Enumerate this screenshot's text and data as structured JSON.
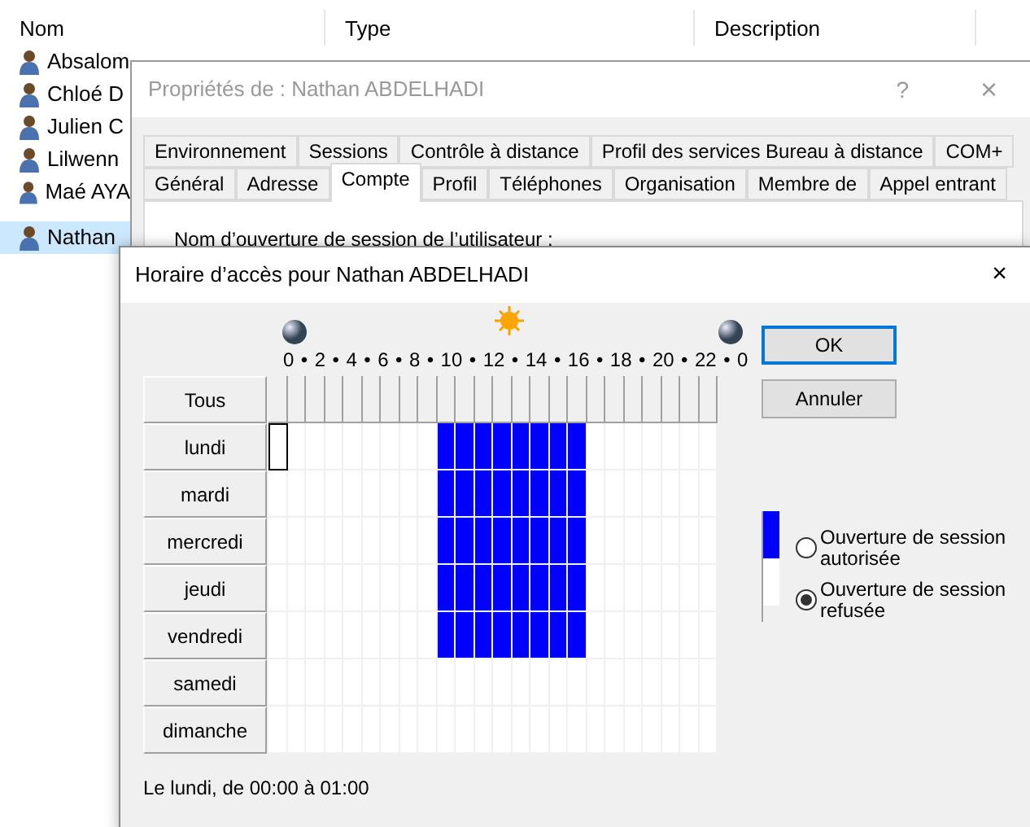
{
  "list": {
    "columns": [
      "Nom",
      "Type",
      "Description"
    ],
    "rows": [
      {
        "name": "Absalom",
        "selected": false
      },
      {
        "name": "Chloé D",
        "selected": false
      },
      {
        "name": "Julien C",
        "selected": false
      },
      {
        "name": "Lilwenn",
        "selected": false
      },
      {
        "name": "Maé AYA",
        "selected": false
      },
      {
        "name": "Nathan",
        "selected": true
      }
    ]
  },
  "properties": {
    "title": "Propriétés de : Nathan ABDELHADI",
    "help": "?",
    "close": "×",
    "tab_rows": [
      [
        {
          "label": "Environnement",
          "selected": false
        },
        {
          "label": "Sessions",
          "selected": false
        },
        {
          "label": "Contrôle à distance",
          "selected": false
        },
        {
          "label": "Profil des services Bureau à distance",
          "selected": false
        },
        {
          "label": "COM+",
          "selected": false
        }
      ],
      [
        {
          "label": "Général",
          "selected": false
        },
        {
          "label": "Adresse",
          "selected": false
        },
        {
          "label": "Compte",
          "selected": true
        },
        {
          "label": "Profil",
          "selected": false
        },
        {
          "label": "Téléphones",
          "selected": false
        },
        {
          "label": "Organisation",
          "selected": false
        },
        {
          "label": "Membre de",
          "selected": false
        },
        {
          "label": "Appel entrant",
          "selected": false
        }
      ]
    ],
    "field_label": "Nom d’ouverture de session de l’utilisateur :"
  },
  "schedule": {
    "title": "Horaire d’accès pour Nathan ABDELHADI",
    "close": "×",
    "hour_labels": [
      "0",
      "2",
      "4",
      "6",
      "8",
      "10",
      "12",
      "14",
      "16",
      "18",
      "20",
      "22",
      "0"
    ],
    "separator": "•",
    "all_label": "Tous",
    "days": [
      {
        "label": "lundi",
        "focused": true,
        "allowed": [
          false,
          false,
          false,
          false,
          false,
          false,
          false,
          false,
          false,
          true,
          true,
          true,
          true,
          true,
          true,
          true,
          true,
          false,
          false,
          false,
          false,
          false,
          false,
          false
        ]
      },
      {
        "label": "mardi",
        "focused": false,
        "allowed": [
          false,
          false,
          false,
          false,
          false,
          false,
          false,
          false,
          false,
          true,
          true,
          true,
          true,
          true,
          true,
          true,
          true,
          false,
          false,
          false,
          false,
          false,
          false,
          false
        ]
      },
      {
        "label": "mercredi",
        "focused": false,
        "allowed": [
          false,
          false,
          false,
          false,
          false,
          false,
          false,
          false,
          false,
          true,
          true,
          true,
          true,
          true,
          true,
          true,
          true,
          false,
          false,
          false,
          false,
          false,
          false,
          false
        ]
      },
      {
        "label": "jeudi",
        "focused": false,
        "allowed": [
          false,
          false,
          false,
          false,
          false,
          false,
          false,
          false,
          false,
          true,
          true,
          true,
          true,
          true,
          true,
          true,
          true,
          false,
          false,
          false,
          false,
          false,
          false,
          false
        ]
      },
      {
        "label": "vendredi",
        "focused": false,
        "allowed": [
          false,
          false,
          false,
          false,
          false,
          false,
          false,
          false,
          false,
          true,
          true,
          true,
          true,
          true,
          true,
          true,
          true,
          false,
          false,
          false,
          false,
          false,
          false,
          false
        ]
      },
      {
        "label": "samedi",
        "focused": false,
        "allowed": [
          false,
          false,
          false,
          false,
          false,
          false,
          false,
          false,
          false,
          false,
          false,
          false,
          false,
          false,
          false,
          false,
          false,
          false,
          false,
          false,
          false,
          false,
          false,
          false
        ]
      },
      {
        "label": "dimanche",
        "focused": false,
        "allowed": [
          false,
          false,
          false,
          false,
          false,
          false,
          false,
          false,
          false,
          false,
          false,
          false,
          false,
          false,
          false,
          false,
          false,
          false,
          false,
          false,
          false,
          false,
          false,
          false
        ]
      }
    ],
    "buttons": [
      {
        "label": "OK",
        "default": true
      },
      {
        "label": "Annuler",
        "default": false
      }
    ],
    "legend": [
      {
        "label": "Ouverture de session autorisée",
        "color": "#0000ff",
        "selected": false
      },
      {
        "label": "Ouverture de session refusée",
        "color": "#ffffff",
        "selected": true
      }
    ],
    "status": "Le lundi, de 00:00 à 01:00"
  }
}
